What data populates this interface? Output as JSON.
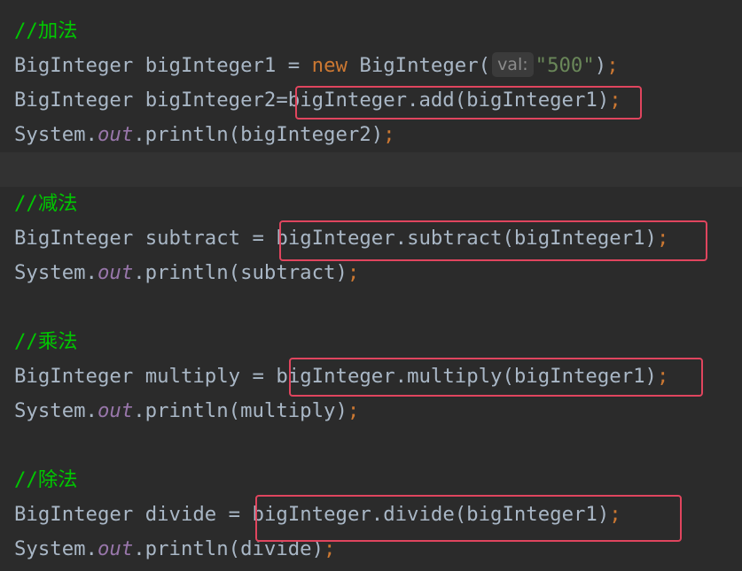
{
  "colors": {
    "background": "#2b2b2b",
    "current_line": "#323232",
    "default_text": "#a9b7c6",
    "comment": "#00c800",
    "keyword": "#cc7832",
    "string": "#6a8759",
    "static_field": "#9876aa",
    "highlight_box": "#e0455e"
  },
  "code": {
    "add": {
      "comment": "//加法",
      "l1": {
        "type": "BigInteger",
        "var": "bigInteger1",
        "eq": "=",
        "kw": "new",
        "ctor": "BigInteger(",
        "hint": "val:",
        "str": "\"500\"",
        "close": ")",
        "semi": ";"
      },
      "l2": {
        "type": "BigInteger",
        "var": "bigInteger2",
        "eq": "=",
        "call": "bigInteger.add(bigInteger1)",
        "semi": ";"
      },
      "l3": {
        "sys": "System.",
        "out": "out",
        "rest": ".println(bigInteger2)",
        "semi": ";"
      }
    },
    "subtract": {
      "comment": "//减法",
      "l1": {
        "type": "BigInteger",
        "var": "subtract",
        "eq": "=",
        "call": "bigInteger.subtract(bigInteger1)",
        "semi": ";"
      },
      "l2": {
        "sys": "System.",
        "out": "out",
        "rest": ".println(subtract)",
        "semi": ";"
      }
    },
    "multiply": {
      "comment": "//乘法",
      "l1": {
        "type": "BigInteger",
        "var": "multiply",
        "eq": "=",
        "call": "bigInteger.multiply(bigInteger1)",
        "semi": ";"
      },
      "l2": {
        "sys": "System.",
        "out": "out",
        "rest": ".println(multiply)",
        "semi": ";"
      }
    },
    "divide": {
      "comment": "//除法",
      "l1": {
        "type": "BigInteger",
        "var": "divide",
        "eq": "=",
        "call": "bigInteger.divide(bigInteger1)",
        "semi": ";"
      },
      "l2": {
        "sys": "System.",
        "out": "out",
        "rest": ".println(divide)",
        "semi": ";"
      }
    }
  }
}
